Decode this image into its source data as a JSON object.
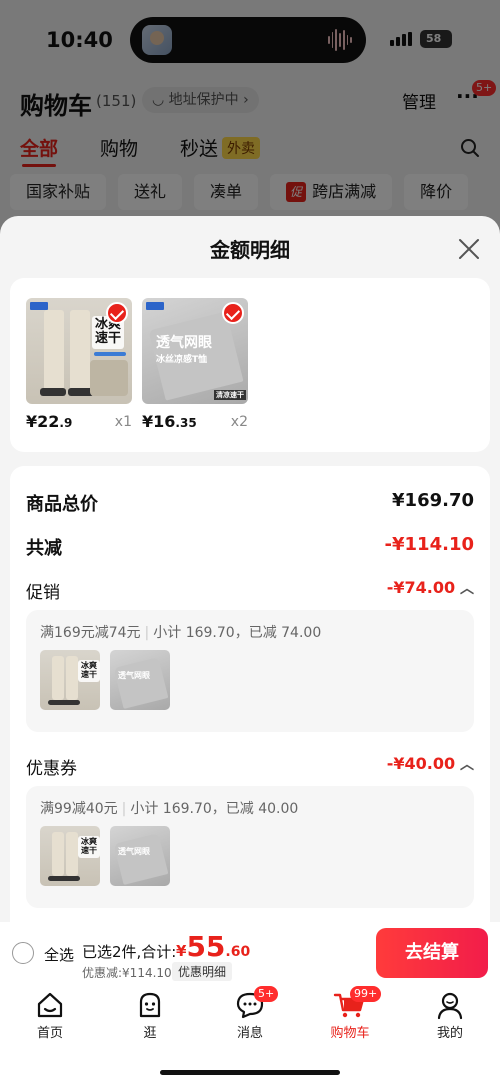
{
  "status": {
    "time": "10:40",
    "battery": "58"
  },
  "cart": {
    "title": "购物车",
    "count": "(151)",
    "address_label": "地址保护中",
    "manage_label": "管理",
    "more_label": "···",
    "more_badge": "5+",
    "tabs": [
      {
        "label": "全部"
      },
      {
        "label": "购物"
      },
      {
        "label": "秒送",
        "tag": "外卖"
      }
    ],
    "filters": [
      {
        "label": "国家补贴"
      },
      {
        "label": "送礼"
      },
      {
        "label": "凑单"
      },
      {
        "label": "跨店满减",
        "tag": "促"
      },
      {
        "label": "降价"
      }
    ]
  },
  "sheet": {
    "title": "金额明细",
    "products": [
      {
        "price_int": "¥22",
        "price_dec": ".9",
        "qty": "x1",
        "overlay_line1": "冰爽",
        "overlay_line2": "速干"
      },
      {
        "price_int": "¥16",
        "price_dec": ".35",
        "qty": "x2",
        "overlay_line1": "透气网眼",
        "overlay_line2": "冰丝凉感T恤",
        "overlay_line3": "清凉速干"
      }
    ],
    "summary": {
      "goods_total_label": "商品总价",
      "goods_total_value": "¥169.70",
      "reduction_label": "共减",
      "reduction_value": "-¥114.10"
    },
    "promo": {
      "label": "促销",
      "value": "-¥74.00",
      "rule": "满169元减74元",
      "detail": "小计 169.70，已减 74.00"
    },
    "coupon": {
      "label": "优惠券",
      "value": "-¥40.00",
      "rule": "满99减40元",
      "detail": "小计 169.70，已减 40.00"
    }
  },
  "checkout": {
    "select_all_label": "全选",
    "selected_text": "已选2件,合计:",
    "total_currency": "¥",
    "total_int": "55",
    "total_dec": ".60",
    "discount_text": "优惠减:¥114.10",
    "detail_link": "优惠明细",
    "button_label": "去结算"
  },
  "tabbar": [
    {
      "label": "首页"
    },
    {
      "label": "逛"
    },
    {
      "label": "消息",
      "badge": "5+"
    },
    {
      "label": "购物车",
      "badge": "99+"
    },
    {
      "label": "我的"
    }
  ],
  "colors": {
    "accent": "#e8221b",
    "checkout_button": "#f22a44"
  }
}
